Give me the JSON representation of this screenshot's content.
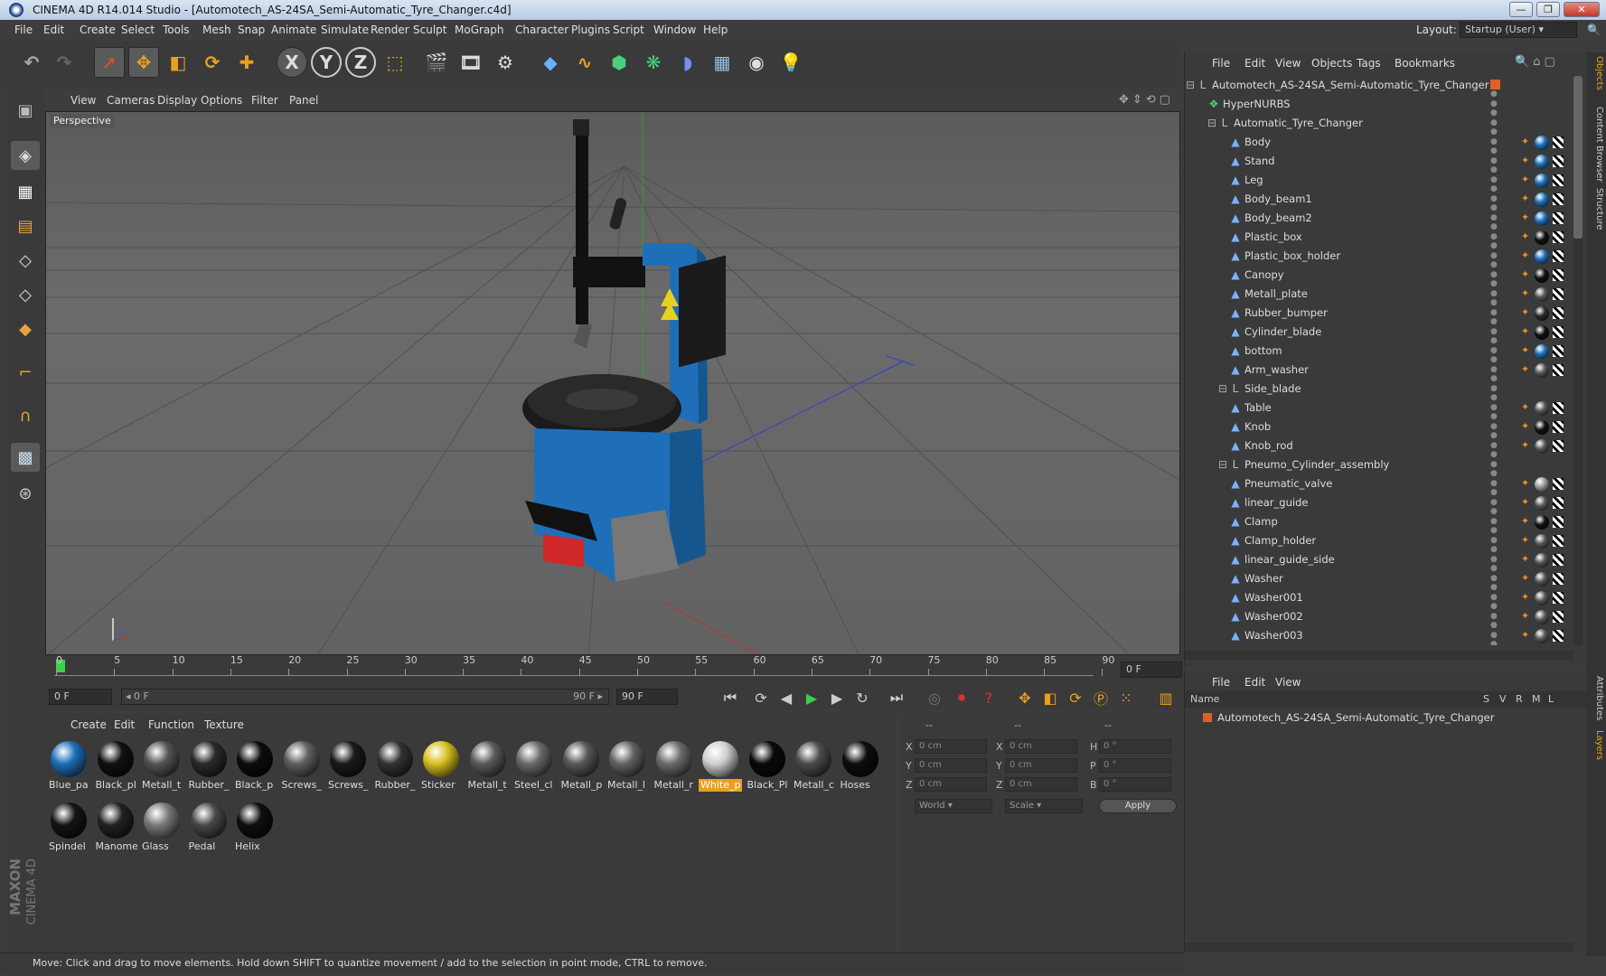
{
  "window": {
    "title": "CINEMA 4D R14.014 Studio - [Automotech_AS-24SA_Semi-Automatic_Tyre_Changer.c4d]",
    "min": "—",
    "max": "❐",
    "close": "✕"
  },
  "menu": [
    "File",
    "Edit",
    "Create",
    "Select",
    "Tools",
    "Mesh",
    "Snap",
    "Animate",
    "Simulate",
    "Render",
    "Sculpt",
    "MoGraph",
    "Character",
    "Plugins",
    "Script",
    "Window",
    "Help"
  ],
  "layout": {
    "label": "Layout:",
    "value": "Startup (User)"
  },
  "toolbar": {
    "x_axis": "X",
    "y_axis": "Y",
    "z_axis": "Z"
  },
  "viewport": {
    "menu": [
      "View",
      "Cameras",
      "Display",
      "Options",
      "Filter",
      "Panel"
    ],
    "camera": "Perspective"
  },
  "timeline": {
    "ticks": [
      "0",
      "5",
      "10",
      "15",
      "20",
      "25",
      "30",
      "35",
      "40",
      "45",
      "50",
      "55",
      "60",
      "65",
      "70",
      "75",
      "80",
      "85",
      "90"
    ],
    "current_frame": "0 F",
    "start": "0 F",
    "range_start": "0 F",
    "range_end": "90 F",
    "end": "90 F"
  },
  "materials": {
    "menu": [
      "Create",
      "Edit",
      "Function",
      "Texture"
    ],
    "items": [
      {
        "label": "Blue_pa",
        "color": "#1e6fb8"
      },
      {
        "label": "Black_pl",
        "color": "#111111"
      },
      {
        "label": "Metall_t",
        "color": "#555555"
      },
      {
        "label": "Rubber_",
        "color": "#2a2a2a"
      },
      {
        "label": "Black_p",
        "color": "#0c0c0c"
      },
      {
        "label": "Screws_",
        "color": "#606060"
      },
      {
        "label": "Screws_",
        "color": "#1a1a1a"
      },
      {
        "label": "Rubber_",
        "color": "#333333"
      },
      {
        "label": "Sticker",
        "color": "#d8c020"
      },
      {
        "label": "Metall_t",
        "color": "#5a5a5a"
      },
      {
        "label": "Steel_cl",
        "color": "#6a6a6a"
      },
      {
        "label": "Metall_p",
        "color": "#585858"
      },
      {
        "label": "Metall_l",
        "color": "#626262"
      },
      {
        "label": "Metall_r",
        "color": "#6c6c6c"
      },
      {
        "label": "White_p",
        "color": "#d0d0d0"
      },
      {
        "label": "Black_Pl",
        "color": "#0a0a0a"
      },
      {
        "label": "Metall_c",
        "color": "#4c4c4c"
      },
      {
        "label": "Hoses",
        "color": "#0d0d0d"
      },
      {
        "label": "Spindel",
        "color": "#141414"
      },
      {
        "label": "Manome",
        "color": "#222222"
      },
      {
        "label": "Glass",
        "color": "#7a7a7a"
      },
      {
        "label": "Pedal",
        "color": "#484848"
      },
      {
        "label": "Helix",
        "color": "#0f0f0f"
      }
    ],
    "selected_index": 14
  },
  "coords": {
    "rows": [
      {
        "a": "X",
        "av": "0 cm",
        "b": "X",
        "bv": "0 cm",
        "c": "H",
        "cv": "0 °"
      },
      {
        "a": "Y",
        "av": "0 cm",
        "b": "Y",
        "bv": "0 cm",
        "c": "P",
        "cv": "0 °"
      },
      {
        "a": "Z",
        "av": "0 cm",
        "b": "Z",
        "bv": "0 cm",
        "c": "B",
        "cv": "0 °"
      }
    ],
    "headers": [
      "--",
      "--",
      "--"
    ],
    "world": "World",
    "scale": "Scale",
    "apply": "Apply"
  },
  "status": "Move: Click and drag to move elements. Hold down SHIFT to quantize movement / add to the selection in point mode, CTRL to remove.",
  "objects": {
    "menu": [
      "File",
      "Edit",
      "View",
      "Objects",
      "Tags",
      "Bookmarks"
    ],
    "rows": [
      {
        "name": "Automotech_AS-24SA_Semi-Automatic_Tyre_Changer",
        "indent": 0,
        "icon": "null",
        "tag": "#e0602a"
      },
      {
        "name": "HyperNURBS",
        "indent": 1,
        "icon": "nurbs",
        "tag": ""
      },
      {
        "name": "Automatic_Tyre_Changer",
        "indent": 2,
        "icon": "null",
        "tag": ""
      },
      {
        "name": "Body",
        "indent": 3,
        "icon": "poly",
        "tag": "#1e6fb8"
      },
      {
        "name": "Stand",
        "indent": 3,
        "icon": "poly",
        "tag": "#1e6fb8"
      },
      {
        "name": "Leg",
        "indent": 3,
        "icon": "poly",
        "tag": "#1e6fb8"
      },
      {
        "name": "Body_beam1",
        "indent": 3,
        "icon": "poly",
        "tag": "#1e6fb8"
      },
      {
        "name": "Body_beam2",
        "indent": 3,
        "icon": "poly",
        "tag": "#1e6fb8"
      },
      {
        "name": "Plastic_box",
        "indent": 3,
        "icon": "poly",
        "tag": "#111111"
      },
      {
        "name": "Plastic_box_holder",
        "indent": 3,
        "icon": "poly",
        "tag": "#1e6fb8"
      },
      {
        "name": "Canopy",
        "indent": 3,
        "icon": "poly",
        "tag": "#111111"
      },
      {
        "name": "Metall_plate",
        "indent": 3,
        "icon": "poly",
        "tag": "#555555"
      },
      {
        "name": "Rubber_bumper",
        "indent": 3,
        "icon": "poly",
        "tag": "#2a2a2a"
      },
      {
        "name": "Cylinder_blade",
        "indent": 3,
        "icon": "poly",
        "tag": "#111111"
      },
      {
        "name": "bottom",
        "indent": 3,
        "icon": "poly",
        "tag": "#1e6fb8"
      },
      {
        "name": "Arm_washer",
        "indent": 3,
        "icon": "poly",
        "tag": "#555555"
      },
      {
        "name": "Side_blade",
        "indent": 3,
        "icon": "null",
        "tag": ""
      },
      {
        "name": "Table",
        "indent": 3,
        "icon": "poly",
        "tag": "#555555"
      },
      {
        "name": "Knob",
        "indent": 3,
        "icon": "poly",
        "tag": "#111111"
      },
      {
        "name": "Knob_rod",
        "indent": 3,
        "icon": "poly",
        "tag": "#555555"
      },
      {
        "name": "Pneumo_Cylinder_assembly",
        "indent": 3,
        "icon": "null",
        "tag": ""
      },
      {
        "name": "Pneumatic_valve",
        "indent": 3,
        "icon": "poly",
        "tag": "#9a9a9a"
      },
      {
        "name": "linear_guide",
        "indent": 3,
        "icon": "poly",
        "tag": "#555555"
      },
      {
        "name": "Clamp",
        "indent": 3,
        "icon": "poly",
        "tag": "#111111"
      },
      {
        "name": "Clamp_holder",
        "indent": 3,
        "icon": "poly",
        "tag": "#555555"
      },
      {
        "name": "linear_guide_side",
        "indent": 3,
        "icon": "poly",
        "tag": "#555555"
      },
      {
        "name": "Washer",
        "indent": 3,
        "icon": "poly",
        "tag": "#555555"
      },
      {
        "name": "Washer001",
        "indent": 3,
        "icon": "poly",
        "tag": "#555555"
      },
      {
        "name": "Washer002",
        "indent": 3,
        "icon": "poly",
        "tag": "#555555"
      },
      {
        "name": "Washer003",
        "indent": 3,
        "icon": "poly",
        "tag": "#555555"
      }
    ]
  },
  "layers": {
    "menu": [
      "File",
      "Edit",
      "View"
    ],
    "cols": [
      "Name",
      "S",
      "V",
      "R",
      "M",
      "L"
    ],
    "row": "Automotech_AS-24SA_Semi-Automatic_Tyre_Changer"
  },
  "right_tabs": [
    "Objects",
    "Content Browser",
    "Structure",
    "Attributes",
    "Layers"
  ],
  "brand": {
    "maxon": "MAXON",
    "c4d": "CINEMA 4D"
  },
  "colors": {
    "accent": "#e8a020",
    "machine_blue": "#1e6fb8"
  }
}
